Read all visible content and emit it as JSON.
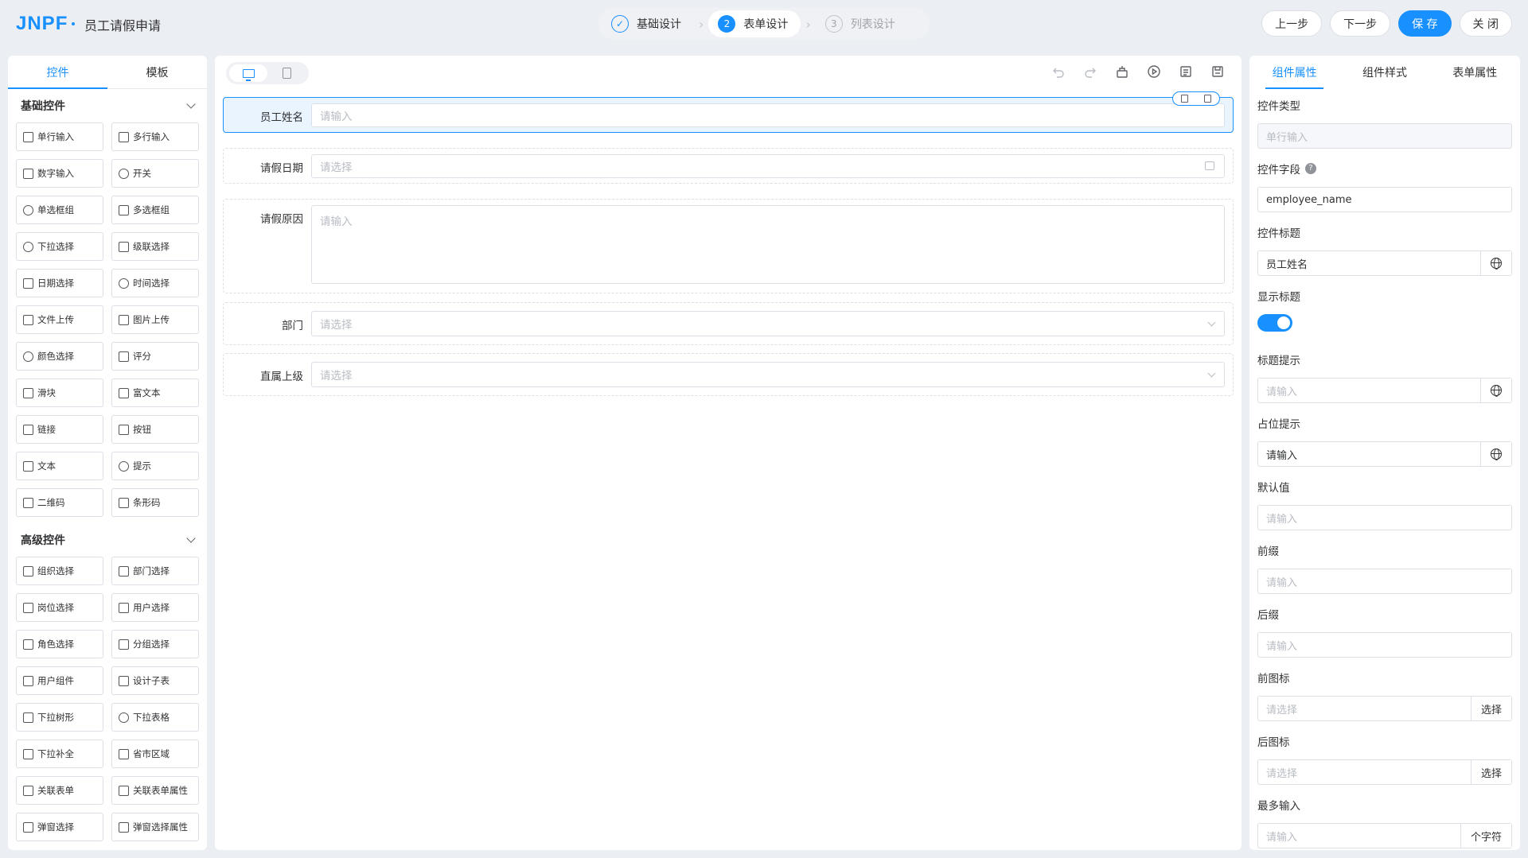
{
  "app": {
    "logo_main": "JNPF",
    "title": "员工请假申请"
  },
  "steps": [
    {
      "num": "✓",
      "label": "基础设计"
    },
    {
      "num": "2",
      "label": "表单设计"
    },
    {
      "num": "3",
      "label": "列表设计"
    }
  ],
  "actions": {
    "prev": "上一步",
    "next": "下一步",
    "save": "保 存",
    "close": "关 闭"
  },
  "left": {
    "tabs": [
      "控件",
      "模板"
    ],
    "basic_title": "基础控件",
    "basic": [
      {
        "label": "单行输入",
        "icon": "input-icon"
      },
      {
        "label": "多行输入",
        "icon": "textarea-icon"
      },
      {
        "label": "数字输入",
        "icon": "number-icon"
      },
      {
        "label": "开关",
        "icon": "switch-icon"
      },
      {
        "label": "单选框组",
        "icon": "radio-icon"
      },
      {
        "label": "多选框组",
        "icon": "checkbox-icon"
      },
      {
        "label": "下拉选择",
        "icon": "select-icon"
      },
      {
        "label": "级联选择",
        "icon": "cascader-icon"
      },
      {
        "label": "日期选择",
        "icon": "calendar-icon"
      },
      {
        "label": "时间选择",
        "icon": "clock-icon"
      },
      {
        "label": "文件上传",
        "icon": "upload-icon"
      },
      {
        "label": "图片上传",
        "icon": "image-upload-icon"
      },
      {
        "label": "颜色选择",
        "icon": "palette-icon"
      },
      {
        "label": "评分",
        "icon": "star-icon"
      },
      {
        "label": "滑块",
        "icon": "slider-icon"
      },
      {
        "label": "富文本",
        "icon": "richtext-icon"
      },
      {
        "label": "链接",
        "icon": "link-icon"
      },
      {
        "label": "按钮",
        "icon": "button-icon"
      },
      {
        "label": "文本",
        "icon": "text-icon"
      },
      {
        "label": "提示",
        "icon": "alert-icon"
      },
      {
        "label": "二维码",
        "icon": "qrcode-icon"
      },
      {
        "label": "条形码",
        "icon": "barcode-icon"
      }
    ],
    "advanced_title": "高级控件",
    "advanced": [
      {
        "label": "组织选择",
        "icon": "org-icon"
      },
      {
        "label": "部门选择",
        "icon": "dept-icon"
      },
      {
        "label": "岗位选择",
        "icon": "position-icon"
      },
      {
        "label": "用户选择",
        "icon": "user-icon"
      },
      {
        "label": "角色选择",
        "icon": "role-icon"
      },
      {
        "label": "分组选择",
        "icon": "group-icon"
      },
      {
        "label": "用户组件",
        "icon": "user-component-icon"
      },
      {
        "label": "设计子表",
        "icon": "table-icon"
      },
      {
        "label": "下拉树形",
        "icon": "tree-icon"
      },
      {
        "label": "下拉表格",
        "icon": "table-select-icon"
      },
      {
        "label": "下拉补全",
        "icon": "autocomplete-icon"
      },
      {
        "label": "省市区域",
        "icon": "area-icon"
      },
      {
        "label": "关联表单",
        "icon": "relation-form-icon"
      },
      {
        "label": "关联表单属性",
        "icon": "relation-attr-icon"
      },
      {
        "label": "弹窗选择",
        "icon": "popup-icon"
      },
      {
        "label": "弹窗选择属性",
        "icon": "popup-attr-icon"
      }
    ]
  },
  "canvas": {
    "fields": [
      {
        "label": "员工姓名",
        "placeholder": "请输入"
      },
      {
        "label": "请假日期",
        "placeholder": "请选择"
      },
      {
        "label": "请假原因",
        "placeholder": "请输入"
      },
      {
        "label": "部门",
        "placeholder": "请选择"
      },
      {
        "label": "直属上级",
        "placeholder": "请选择"
      }
    ]
  },
  "right": {
    "tabs": [
      "组件属性",
      "组件样式",
      "表单属性"
    ],
    "props": {
      "type_label": "控件类型",
      "type_value": "单行输入",
      "field_label": "控件字段",
      "field_help": "?",
      "field_value": "employee_name",
      "title_label": "控件标题",
      "title_value": "员工姓名",
      "show_title_label": "显示标题",
      "tip_label": "标题提示",
      "tip_placeholder": "请输入",
      "placeholder_label": "占位提示",
      "placeholder_value": "请输入",
      "default_label": "默认值",
      "default_placeholder": "请输入",
      "prefix_label": "前缀",
      "prefix_placeholder": "请输入",
      "suffix_label": "后缀",
      "suffix_placeholder": "请输入",
      "prefix_icon_label": "前图标",
      "prefix_icon_placeholder": "请选择",
      "prefix_icon_btn": "选择",
      "suffix_icon_label": "后图标",
      "suffix_icon_placeholder": "请选择",
      "suffix_icon_btn": "选择",
      "maxlength_label": "最多输入",
      "maxlength_placeholder": "请输入",
      "maxlength_unit": "个字符"
    }
  },
  "colors": {
    "primary": "#1890ff",
    "logo_accent": "#ff7a1a",
    "background": "#ebeef2"
  }
}
